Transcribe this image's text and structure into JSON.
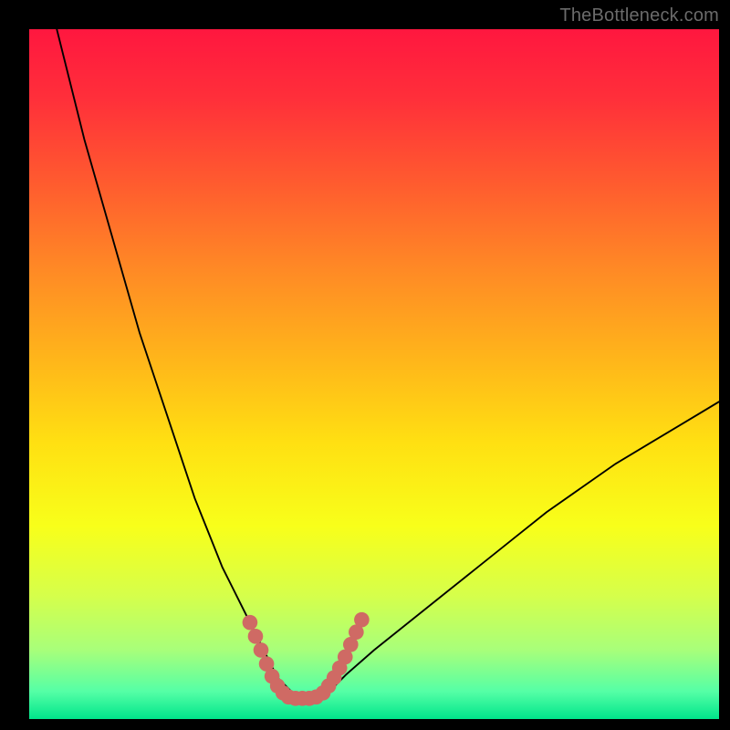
{
  "watermark": "TheBottleneck.com",
  "colors": {
    "black": "#000000",
    "watermark": "#6b6b6b",
    "curve": "#000000",
    "marker": "#cf6a64",
    "gradient_stops": [
      {
        "offset": 0.0,
        "color": "#ff173f"
      },
      {
        "offset": 0.1,
        "color": "#ff2f3a"
      },
      {
        "offset": 0.22,
        "color": "#ff5a2f"
      },
      {
        "offset": 0.35,
        "color": "#ff8a25"
      },
      {
        "offset": 0.48,
        "color": "#ffb61a"
      },
      {
        "offset": 0.6,
        "color": "#ffe012"
      },
      {
        "offset": 0.72,
        "color": "#f8ff1a"
      },
      {
        "offset": 0.82,
        "color": "#d6ff4a"
      },
      {
        "offset": 0.9,
        "color": "#a8ff7a"
      },
      {
        "offset": 0.96,
        "color": "#55ffa6"
      },
      {
        "offset": 1.0,
        "color": "#00e58b"
      }
    ]
  },
  "chart_data": {
    "type": "line",
    "title": "",
    "xlabel": "",
    "ylabel": "",
    "xlim": [
      0,
      100
    ],
    "ylim": [
      0,
      100
    ],
    "grid": false,
    "series": [
      {
        "name": "bottleneck-curve",
        "x": [
          4,
          6,
          8,
          10,
          12,
          14,
          16,
          18,
          20,
          22,
          24,
          26,
          28,
          30,
          32,
          33,
          34,
          35,
          36,
          37,
          38,
          39,
          40,
          41,
          42,
          44,
          46,
          50,
          55,
          60,
          65,
          70,
          75,
          80,
          85,
          90,
          95,
          100
        ],
        "y": [
          100,
          92,
          84,
          77,
          70,
          63,
          56,
          50,
          44,
          38,
          32,
          27,
          22,
          18,
          14,
          12,
          10,
          8,
          6,
          5,
          4,
          3.5,
          3,
          3,
          3.2,
          4.5,
          6.5,
          10,
          14,
          18,
          22,
          26,
          30,
          33.5,
          37,
          40,
          43,
          46
        ]
      }
    ],
    "markers": {
      "name": "trough-markers",
      "color": "#cf6a64",
      "points": [
        {
          "x": 32.0,
          "y": 14.0
        },
        {
          "x": 32.8,
          "y": 12.0
        },
        {
          "x": 33.6,
          "y": 10.0
        },
        {
          "x": 34.4,
          "y": 8.0
        },
        {
          "x": 35.2,
          "y": 6.2
        },
        {
          "x": 36.0,
          "y": 4.8
        },
        {
          "x": 36.8,
          "y": 3.8
        },
        {
          "x": 37.6,
          "y": 3.2
        },
        {
          "x": 38.6,
          "y": 3.0
        },
        {
          "x": 39.6,
          "y": 3.0
        },
        {
          "x": 40.6,
          "y": 3.0
        },
        {
          "x": 41.6,
          "y": 3.2
        },
        {
          "x": 42.6,
          "y": 3.8
        },
        {
          "x": 43.4,
          "y": 4.8
        },
        {
          "x": 44.2,
          "y": 6.0
        },
        {
          "x": 45.0,
          "y": 7.4
        },
        {
          "x": 45.8,
          "y": 9.0
        },
        {
          "x": 46.6,
          "y": 10.8
        },
        {
          "x": 47.4,
          "y": 12.6
        },
        {
          "x": 48.2,
          "y": 14.4
        }
      ]
    }
  }
}
